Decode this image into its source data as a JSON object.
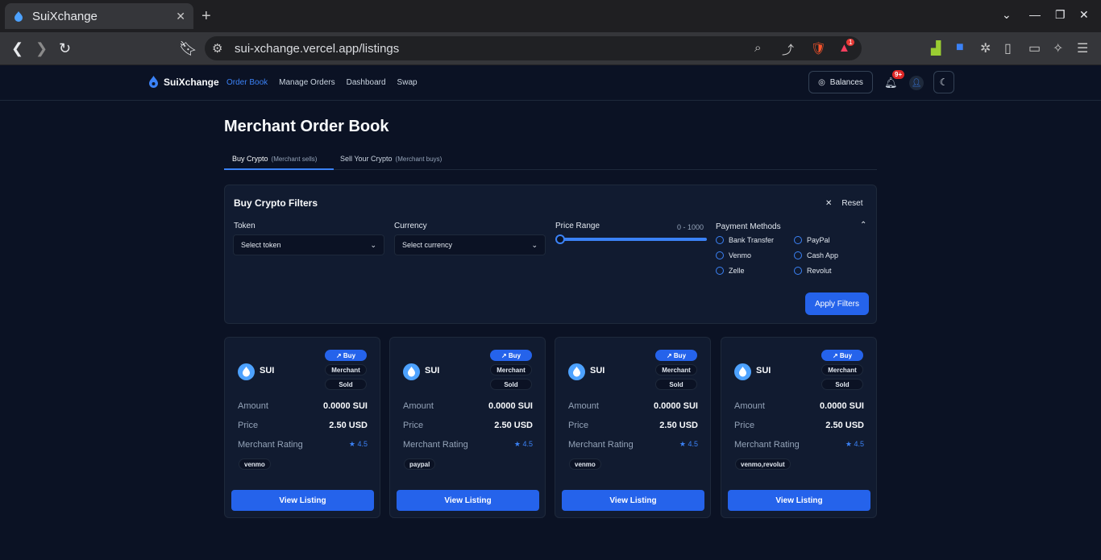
{
  "browser": {
    "tab_title": "SuiXchange",
    "url": "sui-xchange.vercel.app/listings",
    "ext_badge": "1"
  },
  "app": {
    "brand": "SuiXchange",
    "nav": [
      "Order Book",
      "Manage Orders",
      "Dashboard",
      "Swap"
    ],
    "balances": "Balances",
    "notif_count": "9+"
  },
  "page": {
    "title": "Merchant Order Book",
    "tabs": [
      {
        "label": "Buy Crypto",
        "sub": "(Merchant sells)"
      },
      {
        "label": "Sell Your Crypto",
        "sub": "(Merchant buys)"
      }
    ]
  },
  "filters": {
    "title": "Buy Crypto Filters",
    "reset": "Reset",
    "token_label": "Token",
    "token_placeholder": "Select token",
    "currency_label": "Currency",
    "currency_placeholder": "Select currency",
    "price_label": "Price Range",
    "price_value": "0 - 1000",
    "payment_label": "Payment Methods",
    "methods": [
      "Bank Transfer",
      "Venmo",
      "Zelle",
      "PayPal",
      "Cash App",
      "Revolut"
    ],
    "apply": "Apply Filters"
  },
  "cards": [
    {
      "token": "SUI",
      "badges": [
        "Buy",
        "Merchant",
        "Sold"
      ],
      "amount_label": "Amount",
      "amount": "0.0000 SUI",
      "price_label": "Price",
      "price": "2.50 USD",
      "rating_label": "Merchant Rating",
      "rating": "4.5",
      "method": "venmo",
      "cta": "View Listing"
    },
    {
      "token": "SUI",
      "badges": [
        "Buy",
        "Merchant",
        "Sold"
      ],
      "amount_label": "Amount",
      "amount": "0.0000 SUI",
      "price_label": "Price",
      "price": "2.50 USD",
      "rating_label": "Merchant Rating",
      "rating": "4.5",
      "method": "paypal",
      "cta": "View Listing"
    },
    {
      "token": "SUI",
      "badges": [
        "Buy",
        "Merchant",
        "Sold"
      ],
      "amount_label": "Amount",
      "amount": "0.0000 SUI",
      "price_label": "Price",
      "price": "2.50 USD",
      "rating_label": "Merchant Rating",
      "rating": "4.5",
      "method": "venmo",
      "cta": "View Listing"
    },
    {
      "token": "SUI",
      "badges": [
        "Buy",
        "Merchant",
        "Sold"
      ],
      "amount_label": "Amount",
      "amount": "0.0000 SUI",
      "price_label": "Price",
      "price": "2.50 USD",
      "rating_label": "Merchant Rating",
      "rating": "4.5",
      "method": "venmo,revolut",
      "cta": "View Listing"
    }
  ],
  "colors": {
    "accent": "#2563eb",
    "background": "#0b1224",
    "panel": "#111b30"
  }
}
